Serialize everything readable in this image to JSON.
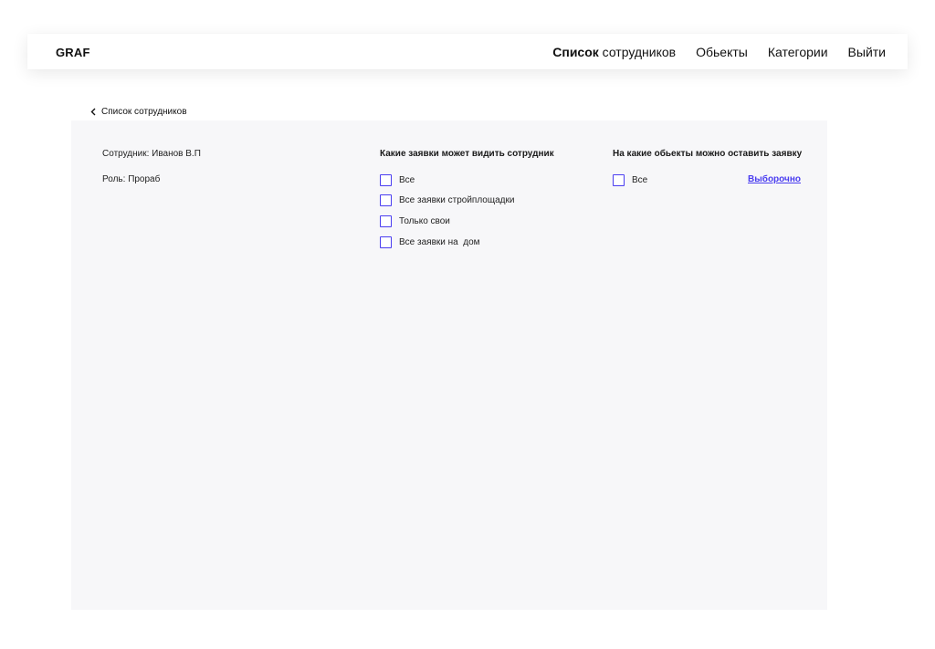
{
  "header": {
    "logo": "GRAF",
    "nav": [
      {
        "bold": "Список",
        "rest": " сотрудников"
      },
      {
        "bold": "",
        "rest": "Обьекты"
      },
      {
        "bold": "",
        "rest": "Категории"
      },
      {
        "bold": "",
        "rest": "Выйти"
      }
    ]
  },
  "breadcrumb": {
    "back_label": "Список сотрудников"
  },
  "employee": {
    "name_label": "Сотрудник:",
    "name_value": "Иванов В.П",
    "role_label": "Роль:",
    "role_value": "Прораб"
  },
  "visibility": {
    "title": "Какие заявки может видить сотрудник",
    "options": [
      "Все",
      "Все заявки стройплощадки",
      "Только свои",
      "Все заявки на  дом"
    ]
  },
  "objects": {
    "title": "На какие обьекты можно оставить заявку",
    "options": [
      "Все"
    ],
    "select_link": "Выборочно"
  },
  "colors": {
    "accent": "#4a3df0",
    "panel_bg": "#f7f7f9"
  }
}
